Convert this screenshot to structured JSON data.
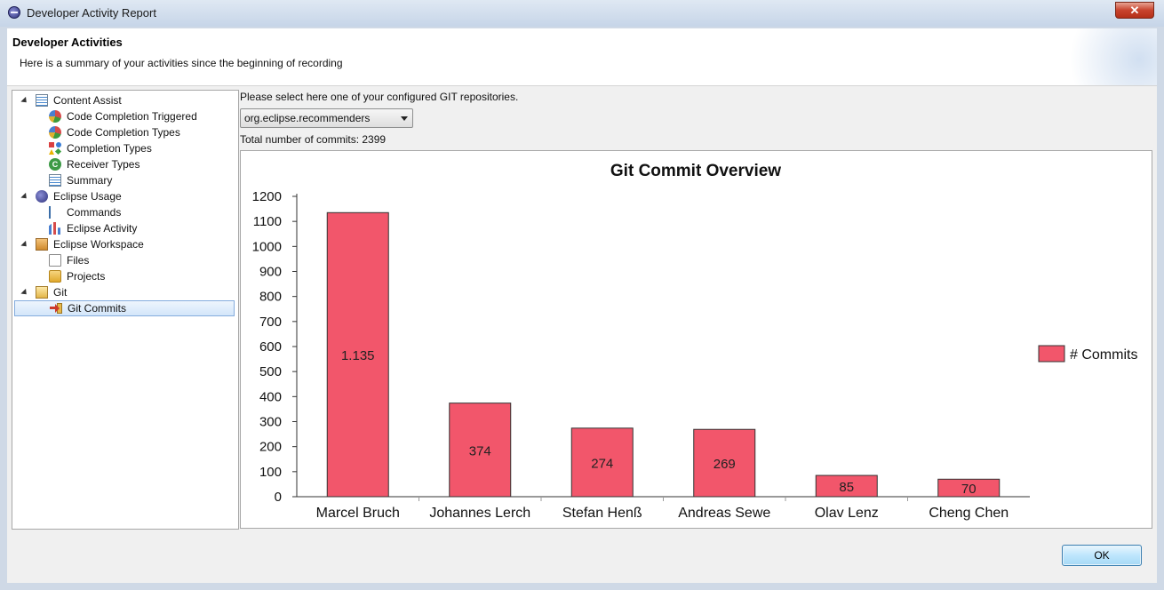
{
  "window": {
    "title": "Developer Activity Report",
    "close_label": "✕"
  },
  "header": {
    "title": "Developer Activities",
    "description": "Here is a summary of your activities since the beginning of recording"
  },
  "tree": [
    {
      "label": "Content Assist",
      "icon": "list-icon",
      "level": 0,
      "expanded": true
    },
    {
      "label": "Code Completion Triggered",
      "icon": "pie-chart-icon",
      "level": 1
    },
    {
      "label": "Code Completion Types",
      "icon": "pie-chart-icon",
      "level": 1
    },
    {
      "label": "Completion Types",
      "icon": "shapes-icon",
      "level": 1
    },
    {
      "label": "Receiver Types",
      "icon": "class-icon",
      "level": 1
    },
    {
      "label": "Summary",
      "icon": "list-icon",
      "level": 1
    },
    {
      "label": "Eclipse Usage",
      "icon": "eclipse-icon",
      "level": 0,
      "expanded": true
    },
    {
      "label": "Commands",
      "icon": "commands-icon",
      "level": 1
    },
    {
      "label": "Eclipse Activity",
      "icon": "bar-chart-icon",
      "level": 1
    },
    {
      "label": "Eclipse Workspace",
      "icon": "workspace-icon",
      "level": 0,
      "expanded": true
    },
    {
      "label": "Files",
      "icon": "file-icon",
      "level": 1
    },
    {
      "label": "Projects",
      "icon": "folder-icon",
      "level": 1
    },
    {
      "label": "Git",
      "icon": "git-icon",
      "level": 0,
      "expanded": true
    },
    {
      "label": "Git Commits",
      "icon": "git-commit-icon",
      "level": 1,
      "selected": true
    }
  ],
  "repository": {
    "prompt": "Please select here one of your configured GIT repositories.",
    "selected": "org.eclipse.recommenders",
    "total_commits_text": "Total number of commits: 2399"
  },
  "chart_data": {
    "type": "bar",
    "title": "Git Commit Overview",
    "categories": [
      "Marcel Bruch",
      "Johannes Lerch",
      "Stefan Henß",
      "Andreas Sewe",
      "Olav Lenz",
      "Cheng Chen"
    ],
    "series": [
      {
        "name": "# Commits",
        "values": [
          1135,
          374,
          274,
          269,
          85,
          70
        ],
        "data_labels": [
          "1.135",
          "374",
          "274",
          "269",
          "85",
          "70"
        ],
        "color": "#f2566b"
      }
    ],
    "ylim": [
      0,
      1200
    ],
    "yticks": [
      0,
      100,
      200,
      300,
      400,
      500,
      600,
      700,
      800,
      900,
      1000,
      1100,
      1200
    ],
    "xlabel": "",
    "ylabel": "",
    "grid": false,
    "legend_position": "right"
  },
  "footer": {
    "ok_label": "OK"
  },
  "colors": {
    "bar": "#f2566b",
    "bar_border": "#333333",
    "selection": "#d3e6fa"
  }
}
